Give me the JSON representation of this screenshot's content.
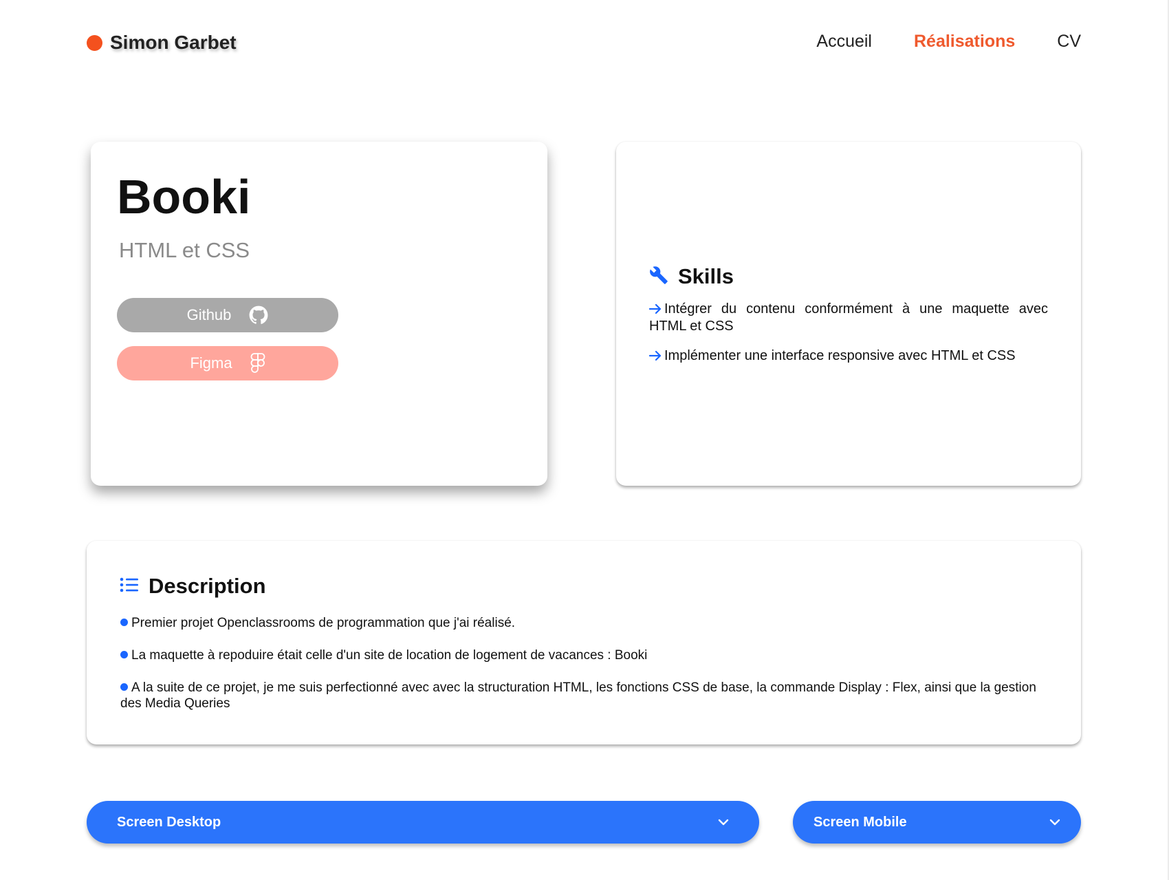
{
  "header": {
    "brand_name": "Simon Garbet",
    "nav": [
      {
        "label": "Accueil",
        "active": false
      },
      {
        "label": "Réalisations",
        "active": true
      },
      {
        "label": "CV",
        "active": false
      }
    ]
  },
  "project": {
    "title": "Booki",
    "subtitle": "HTML et CSS",
    "links": {
      "github": {
        "label": "Github",
        "icon": "github-icon"
      },
      "figma": {
        "label": "Figma",
        "icon": "figma-icon"
      }
    }
  },
  "skills": {
    "title": "Skills",
    "icon": "wrench-icon",
    "items": [
      "Intégrer du contenu conformément à une maquette avec HTML et CSS",
      "Implémenter une interface responsive avec HTML et CSS"
    ]
  },
  "description": {
    "title": "Description",
    "icon": "list-icon",
    "items": [
      "Premier projet Openclassrooms de programmation que j'ai réalisé.",
      "La maquette à repoduire était celle d'un site de location de logement de vacances : Booki",
      "A la suite de ce projet, je me suis perfectionné avec avec la structuration HTML, les fonctions CSS de base, la commande Display : Flex, ainsi que la gestion des Media Queries"
    ]
  },
  "accordions": {
    "desktop": {
      "label": "Screen Desktop",
      "icon": "chevron-down-icon"
    },
    "mobile": {
      "label": "Screen Mobile",
      "icon": "chevron-down-icon"
    }
  },
  "colors": {
    "accent_orange": "#ef5a2e",
    "accent_blue": "#2b74fb",
    "github_button": "#a9a9a9",
    "figma_button": "#ffa69c"
  }
}
